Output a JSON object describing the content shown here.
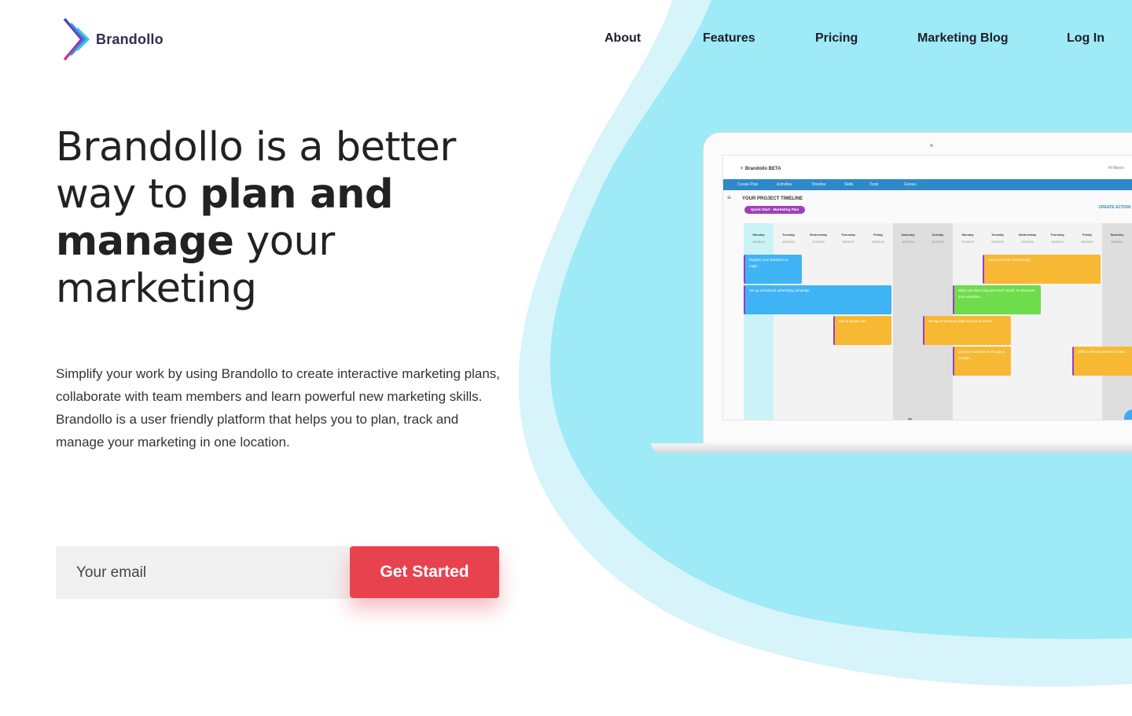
{
  "brand": {
    "name": "Brandollo"
  },
  "nav": {
    "about": "About",
    "features": "Features",
    "pricing": "Pricing",
    "blog": "Marketing Blog",
    "login": "Log In"
  },
  "hero": {
    "headline_part1": "Brandollo is a better way to ",
    "headline_bold1": "plan and manage",
    "headline_part2": " your marketing",
    "description": "Simplify your work by using Brandollo to create interactive marketing plans, collaborate with team members and learn powerful new marketing skills. Brandollo is a user friendly platform that helps you to plan, track and manage your marketing in one location."
  },
  "signup": {
    "email_placeholder": "Your email",
    "cta_label": "Get Started"
  },
  "colors": {
    "cta": "#e8424f",
    "blob": "#9eeaf7",
    "blob_light": "#d6f4fa",
    "app_menu": "#2d89c9"
  },
  "app_preview": {
    "logo": "Brandollo BETA",
    "user": "Hi Marco",
    "menu": [
      "Create Plan",
      "Activities",
      "Timeline",
      "Skills",
      "Tools",
      "Genius"
    ],
    "title": "YOUR PROJECT TIMELINE",
    "chip": "Quick Start - Marketing Plan",
    "create": "CREATE ACTION",
    "days": [
      {
        "day": "Monday",
        "date": "25/03/19"
      },
      {
        "day": "Tuesday",
        "date": "26/03/19"
      },
      {
        "day": "Wednesday",
        "date": "27/03/19"
      },
      {
        "day": "Thursday",
        "date": "28/03/19"
      },
      {
        "day": "Friday",
        "date": "29/03/19"
      },
      {
        "day": "Saturday",
        "date": "30/03/19"
      },
      {
        "day": "Sunday",
        "date": "31/03/19"
      },
      {
        "day": "Monday",
        "date": "01/04/19"
      },
      {
        "day": "Tuesday",
        "date": "02/04/19"
      },
      {
        "day": "Wednesday",
        "date": "03/04/19"
      },
      {
        "day": "Thursday",
        "date": "04/04/19"
      },
      {
        "day": "Friday",
        "date": "05/04/19"
      },
      {
        "day": "Saturday",
        "date": "06/04/19"
      }
    ],
    "tasks": [
      "Register your business on major...",
      "Set up a facebook advertising campaign",
      "Set up google ads",
      "Set up a Facebook page for your business",
      "Get 5 customer testimonials",
      "Write one short blog post each month, to showcase your expertise...",
      "List your business on Google & Google...",
      "Offer a referral scheme for new..."
    ]
  }
}
